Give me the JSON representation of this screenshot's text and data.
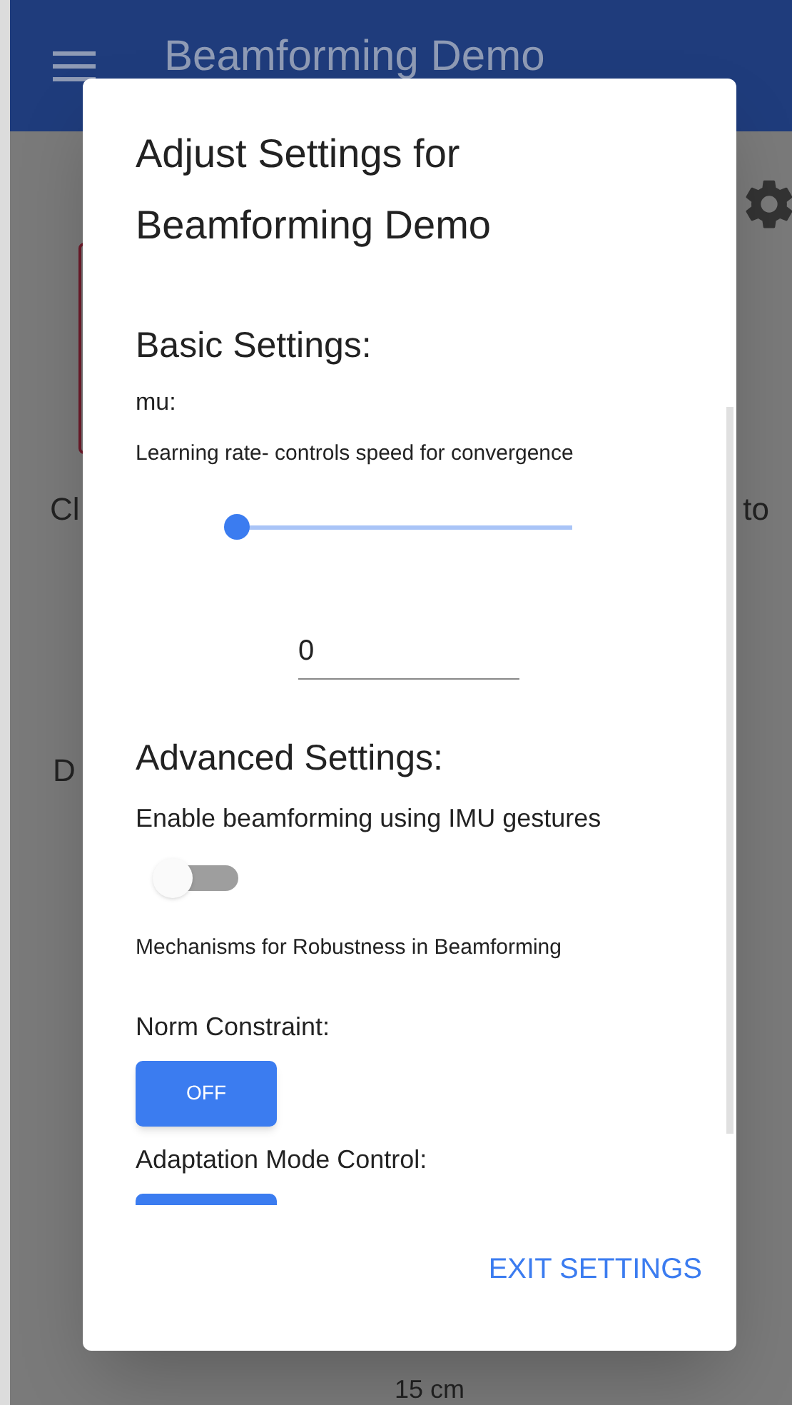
{
  "app_bar": {
    "title": "Beamforming Demo"
  },
  "background": {
    "left_text": "Cl",
    "right_text": "to",
    "middle_text": "D",
    "bottom_text": "15 cm"
  },
  "dialog": {
    "title": "Adjust Settings for Beamforming Demo",
    "basic": {
      "heading": "Basic Settings:",
      "param_label": "mu:",
      "param_description": "Learning rate- controls speed for convergence",
      "slider": {
        "level": 0
      },
      "value_field": {
        "value": "0"
      }
    },
    "advanced": {
      "heading": "Advanced Settings:",
      "imu_label": "Enable beamforming using IMU gestures",
      "imu_switch": {
        "on": false
      },
      "robustness_label": "Mechanisms for Robustness in Beamforming",
      "norm_constraint": {
        "label": "Norm Constraint:",
        "button": "OFF"
      },
      "adaptation_mode": {
        "label": "Adaptation Mode Control:"
      }
    },
    "exit_button": "EXIT SETTINGS"
  }
}
